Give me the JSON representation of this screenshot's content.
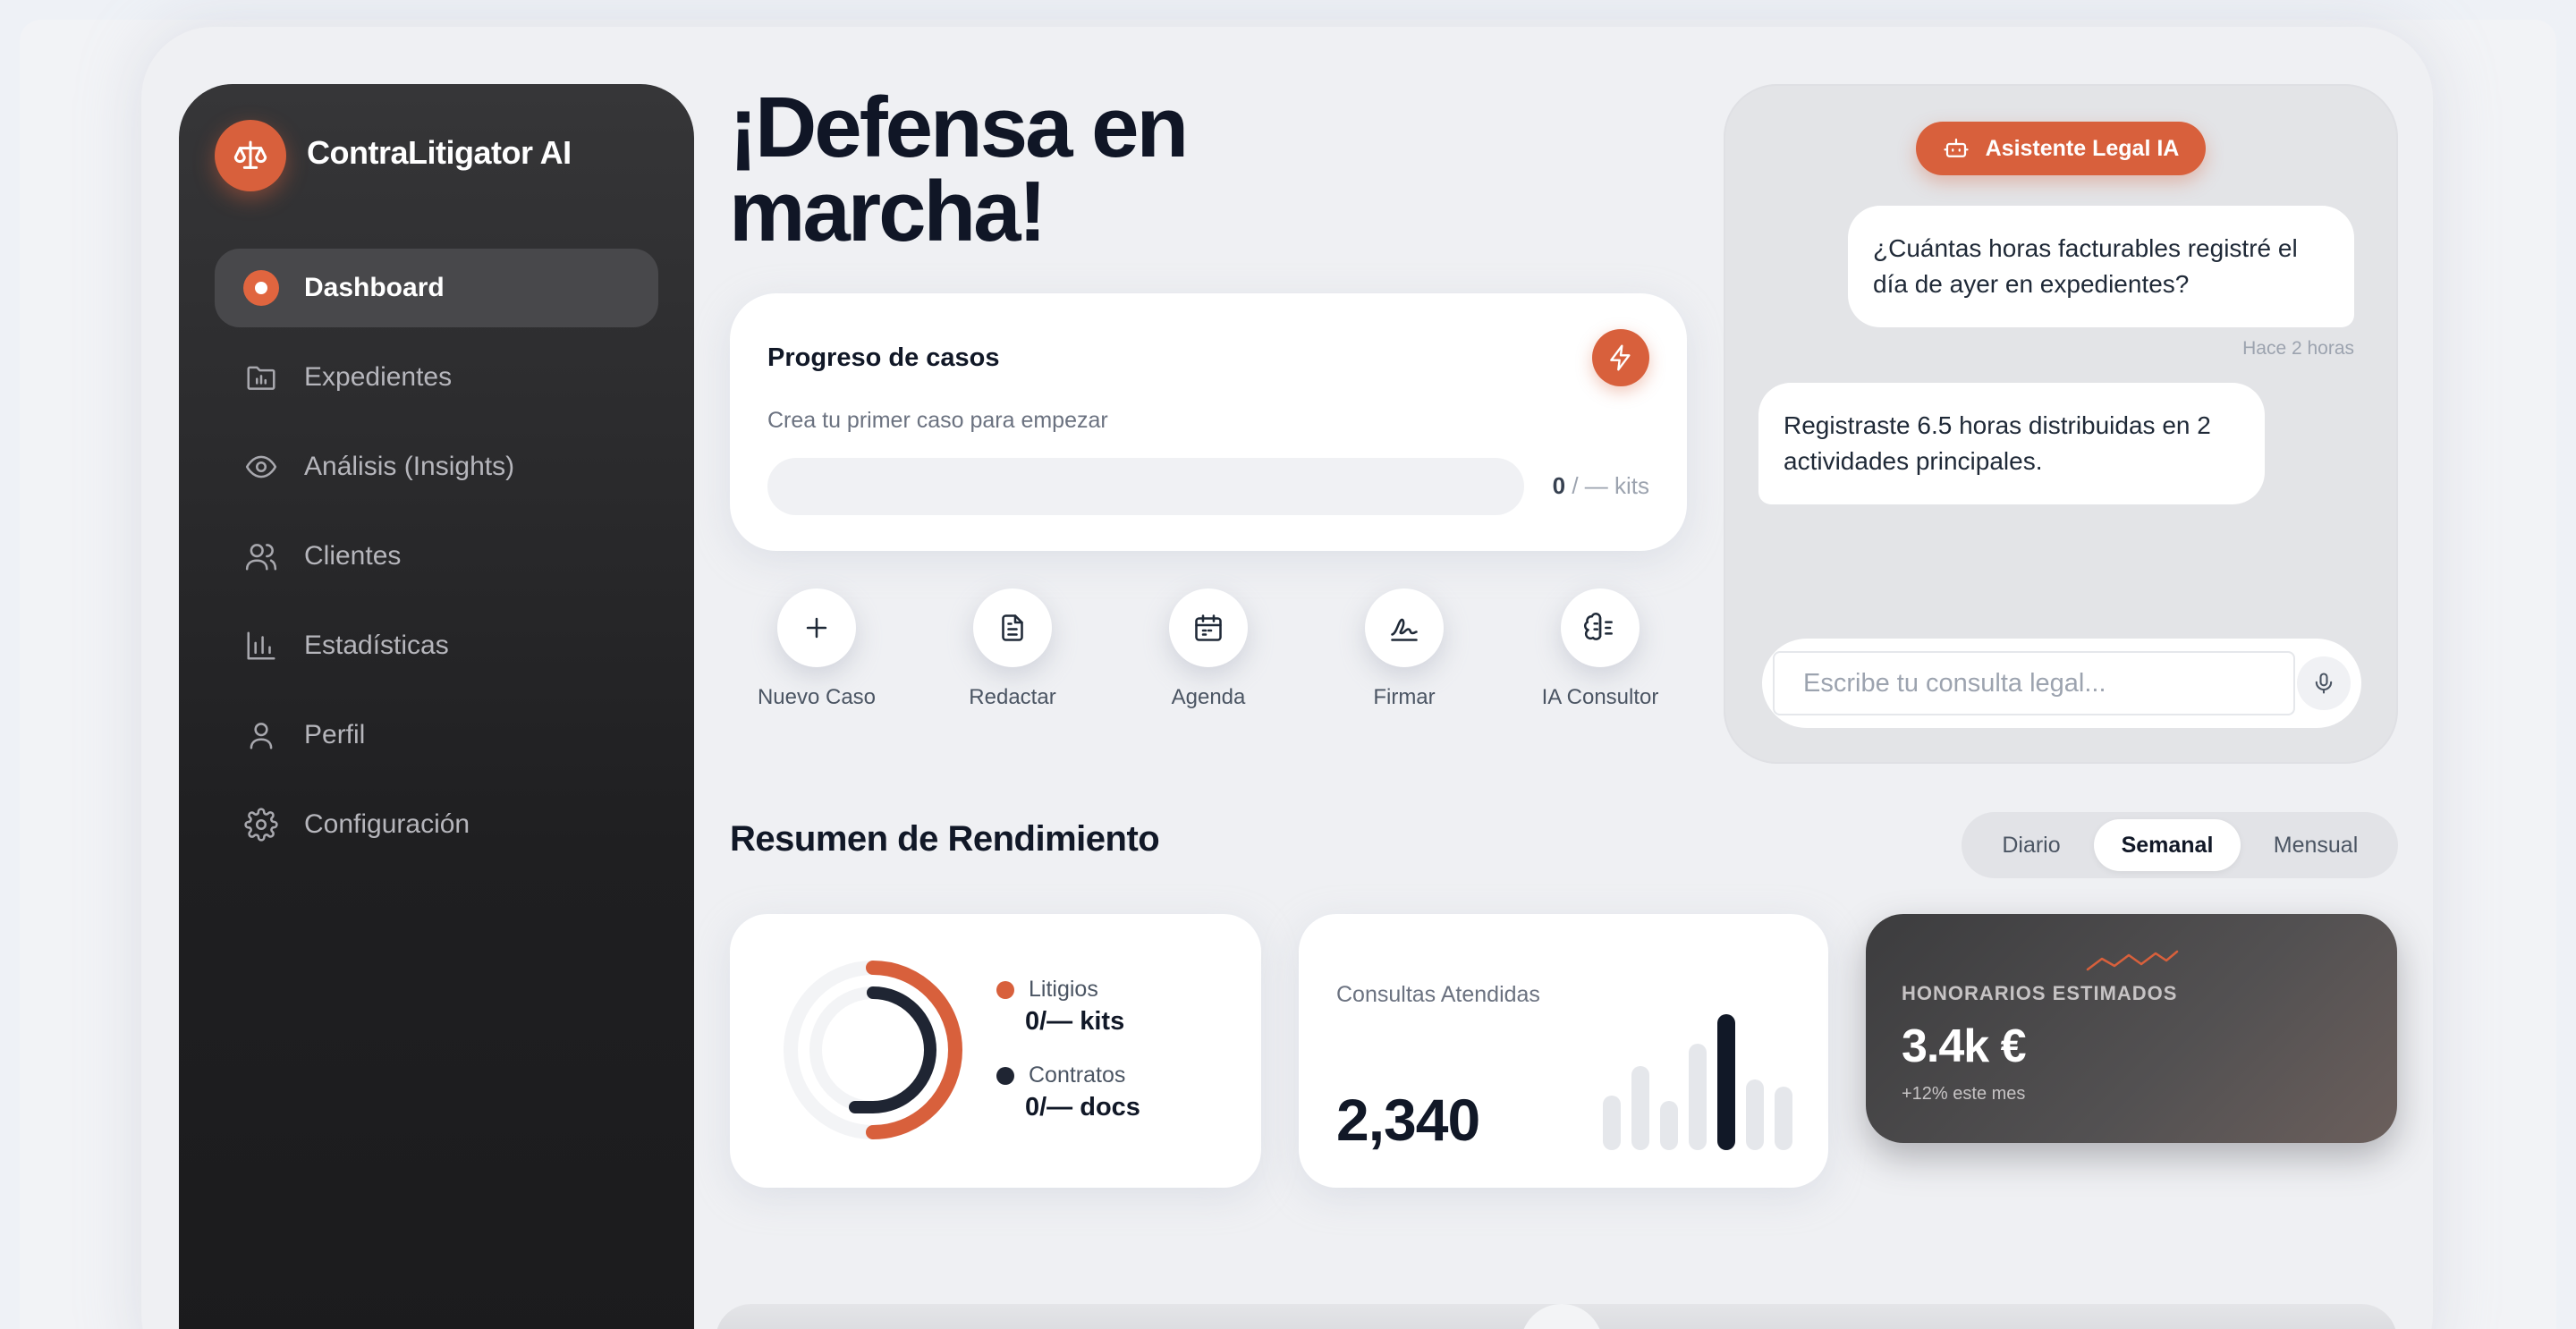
{
  "app": {
    "name": "ContraLitigator AI",
    "brand_color": "#d8603c",
    "logo_icon": "scale-icon"
  },
  "sidebar": {
    "items": [
      {
        "label": "Dashboard",
        "icon": "active-dot-icon",
        "active": true
      },
      {
        "label": "Expedientes",
        "icon": "folder-chart-icon",
        "active": false
      },
      {
        "label": "Análisis (Insights)",
        "icon": "eye-icon",
        "active": false
      },
      {
        "label": "Clientes",
        "icon": "users-icon",
        "active": false
      },
      {
        "label": "Estadísticas",
        "icon": "bar-chart-icon",
        "active": false
      },
      {
        "label": "Perfil",
        "icon": "user-icon",
        "active": false
      },
      {
        "label": "Configuración",
        "icon": "gear-icon",
        "active": false
      }
    ]
  },
  "hero": {
    "line1": "¡Defensa en",
    "line2": "marcha!"
  },
  "progress": {
    "title": "Progreso de casos",
    "subtitle": "Crea tu primer caso para empezar",
    "count": "0",
    "total": " / — kits",
    "percent": 0,
    "icon": "bolt-icon"
  },
  "quick_actions": [
    {
      "label": "Nuevo Caso",
      "icon": "plus-icon"
    },
    {
      "label": "Redactar",
      "icon": "document-icon"
    },
    {
      "label": "Agenda",
      "icon": "calendar-icon"
    },
    {
      "label": "Firmar",
      "icon": "signature-icon"
    },
    {
      "label": "IA Consultor",
      "icon": "brain-icon"
    }
  ],
  "chat": {
    "badge": "Asistente Legal IA",
    "badge_icon": "robot-icon",
    "user_message": "¿Cuántas horas facturables registré el día de ayer en expedientes?",
    "timestamp": "Hace 2 horas",
    "ai_message": "Registraste 6.5 horas distribuidas en 2 actividades principales.",
    "input_placeholder": "Escribe tu consulta legal...",
    "mic_icon": "microphone-icon"
  },
  "performance": {
    "title": "Resumen de Rendimiento",
    "tabs": [
      {
        "label": "Diario",
        "active": false
      },
      {
        "label": "Semanal",
        "active": true
      },
      {
        "label": "Mensual",
        "active": false
      }
    ],
    "donut": {
      "litigios_label": "Litigios",
      "litigios_value": "0/— kits",
      "litigios_color": "#d8603c",
      "contratos_label": "Contratos",
      "contratos_value": "0/— docs",
      "contratos_color": "#1f2533"
    },
    "consultas": {
      "label": "Consultas Atendidas",
      "value": "2,340",
      "bars": [
        0.4,
        0.62,
        0.36,
        0.78,
        1.0,
        0.52,
        0.47
      ],
      "highlight_index": 4
    },
    "honorarios": {
      "label": "HONORARIOS ESTIMADOS",
      "value": "3.4k €",
      "sub": "+12% este mes"
    }
  }
}
